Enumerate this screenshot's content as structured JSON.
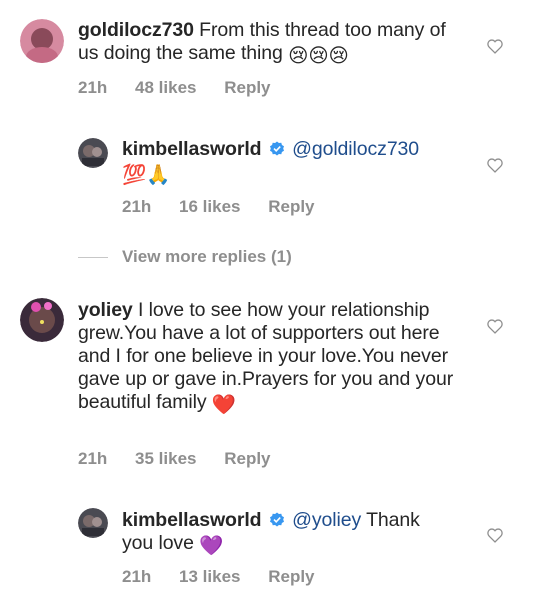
{
  "comments": [
    {
      "username": "goldilocz730",
      "text": "From this thread too many of us doing the same thing",
      "emojis": "😢😢😢",
      "time": "21h",
      "likes": "48 likes",
      "reply": "Reply"
    },
    {
      "username": "kimbellasworld",
      "verified": true,
      "mention": "@goldilocz730",
      "emojis": "💯🙏",
      "time": "21h",
      "likes": "16 likes",
      "reply": "Reply"
    },
    {
      "username": "yoliey",
      "text": "I love to see how your relationship grew.You have a lot of supporters out here and I for one believe in your love.You never gave up or gave in.Prayers for you and your beautiful family",
      "emojis": "❤️",
      "time": "21h",
      "likes": "35 likes",
      "reply": "Reply"
    },
    {
      "username": "kimbellasworld",
      "verified": true,
      "mention": "@yoliey",
      "text": "Thank you love",
      "emojis": "💜",
      "time": "21h",
      "likes": "13 likes",
      "reply": "Reply"
    }
  ],
  "view_more": "View more replies (1)",
  "colors": {
    "text": "#262626",
    "meta": "#8e8e8e",
    "mention": "#1f4d8c",
    "verified": "#3897f0"
  }
}
